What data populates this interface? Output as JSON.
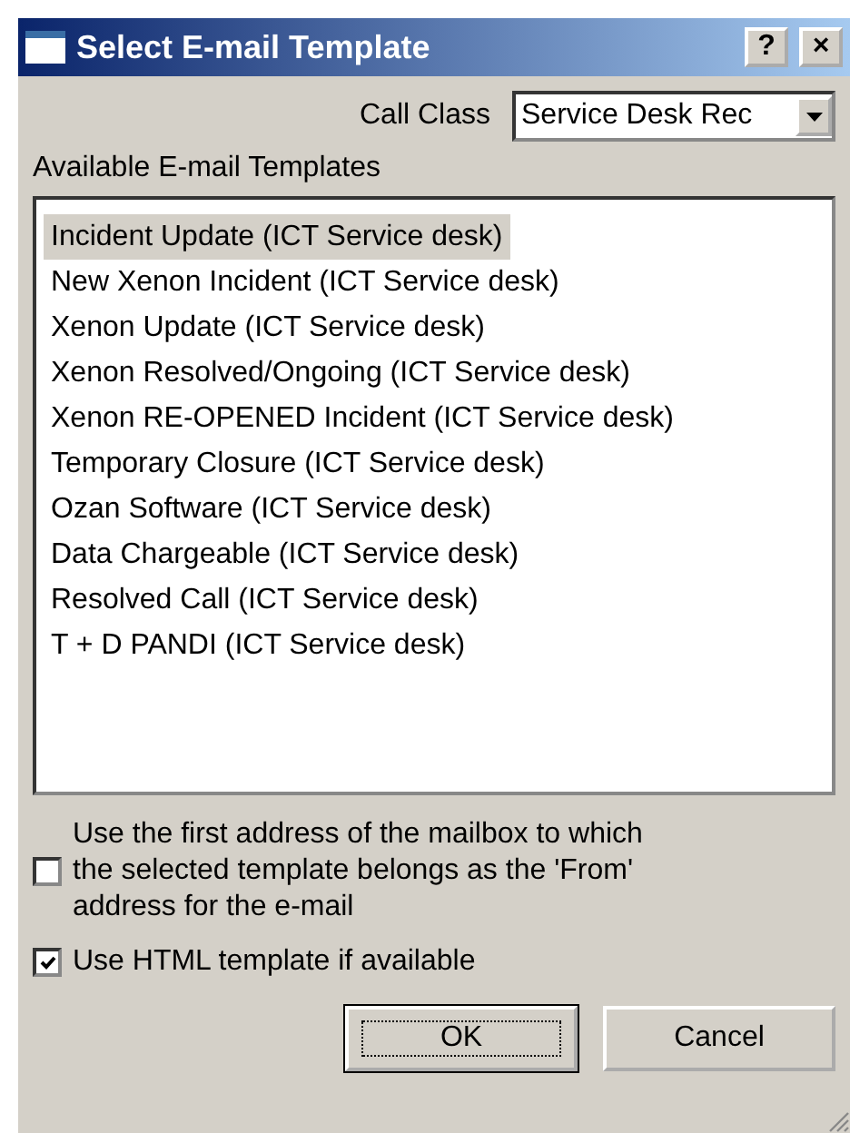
{
  "window": {
    "title": "Select E-mail Template",
    "help_button": "?",
    "close_button": "×"
  },
  "call_class": {
    "label": "Call Class",
    "value": "Service Desk Rec"
  },
  "templates_label": "Available E-mail Templates",
  "templates": [
    {
      "label": "Incident Update (ICT Service desk)",
      "selected": true
    },
    {
      "label": "New Xenon Incident (ICT Service desk)",
      "selected": false
    },
    {
      "label": "Xenon Update (ICT Service desk)",
      "selected": false
    },
    {
      "label": "Xenon Resolved/Ongoing (ICT Service desk)",
      "selected": false
    },
    {
      "label": "Xenon RE-OPENED Incident (ICT Service desk)",
      "selected": false
    },
    {
      "label": "Temporary Closure (ICT Service desk)",
      "selected": false
    },
    {
      "label": "Ozan Software (ICT Service desk)",
      "selected": false
    },
    {
      "label": "Data Chargeable (ICT Service desk)",
      "selected": false
    },
    {
      "label": "Resolved Call (ICT Service desk)",
      "selected": false
    },
    {
      "label": "T + D PANDI (ICT Service desk)",
      "selected": false
    }
  ],
  "options": [
    {
      "label": "Use the first address of the mailbox to which the selected template belongs as the 'From' address for the e-mail",
      "checked": false
    },
    {
      "label": "Use HTML template if available",
      "checked": true
    }
  ],
  "buttons": [
    {
      "label": "OK",
      "default": true
    },
    {
      "label": "Cancel",
      "default": false
    }
  ]
}
